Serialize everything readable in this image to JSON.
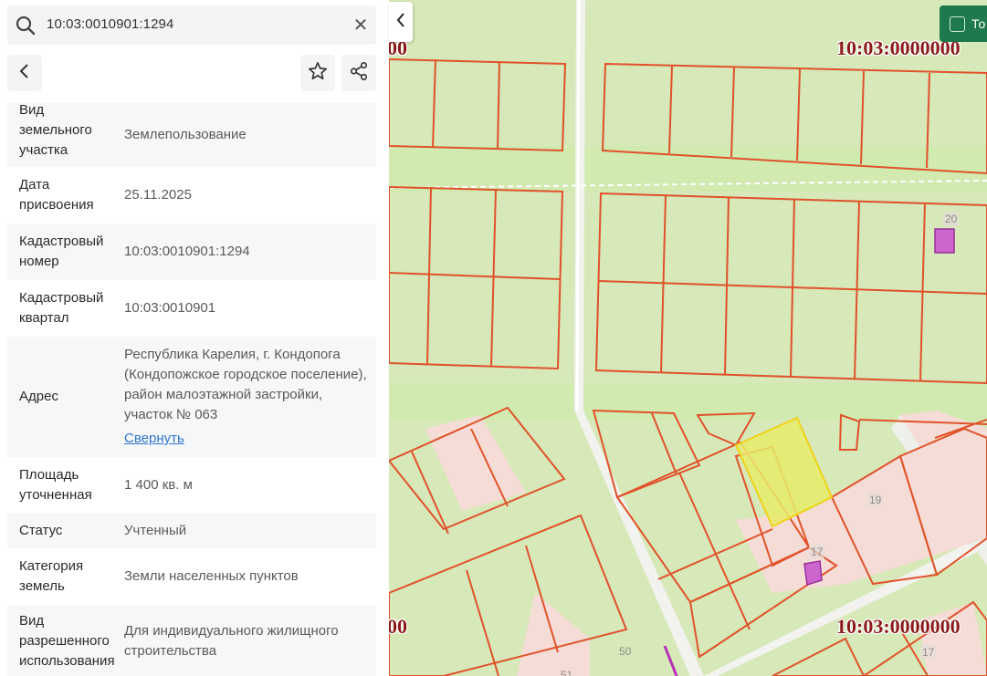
{
  "search": {
    "value": "10:03:0010901:1294",
    "icon": "search-icon",
    "clear_icon": "close-icon",
    "clear_glyph": "✕"
  },
  "toolbar": {
    "back_icon": "chevron-left-icon",
    "favorite_icon": "star-icon",
    "share_icon": "share-icon"
  },
  "details": [
    {
      "label": "Вид земельного участка",
      "value": "Землепользование"
    },
    {
      "label": "Дата присвоения",
      "value": "25.11.2025"
    },
    {
      "label": "Кадастровый номер",
      "value": "10:03:0010901:1294"
    },
    {
      "label": "Кадастровый квартал",
      "value": "10:03:0010901"
    },
    {
      "label": "Адрес",
      "value": "Республика Карелия, г. Кондопога (Кондопожское городское поселение), район малоэтажной застройки, участок № 063",
      "link": "Свернуть"
    },
    {
      "label": "Площадь уточненная",
      "value": "1 400 кв. м"
    },
    {
      "label": "Статус",
      "value": "Учтенный"
    },
    {
      "label": "Категория земель",
      "value": "Земли населенных пунктов"
    },
    {
      "label": "Вид разрешенного использования",
      "value": "Для индивидуального жилищного строительства"
    }
  ],
  "map": {
    "collapse_icon": "chevron-left-icon",
    "green_button_label": "То",
    "quarter_labels": [
      "00",
      "10:03:0000000",
      "00",
      "10:03:0000000"
    ],
    "parcel_numbers": [
      "20",
      "19",
      "17",
      "50",
      "51",
      "17"
    ],
    "colors": {
      "background": "#d5e6b7",
      "parcel_stroke": "#e0522a",
      "built_area": "#f6dcd6",
      "selected_fill": "#e7ec6a",
      "selected_stroke": "#f0d21a",
      "building": "#cc66cc"
    }
  }
}
